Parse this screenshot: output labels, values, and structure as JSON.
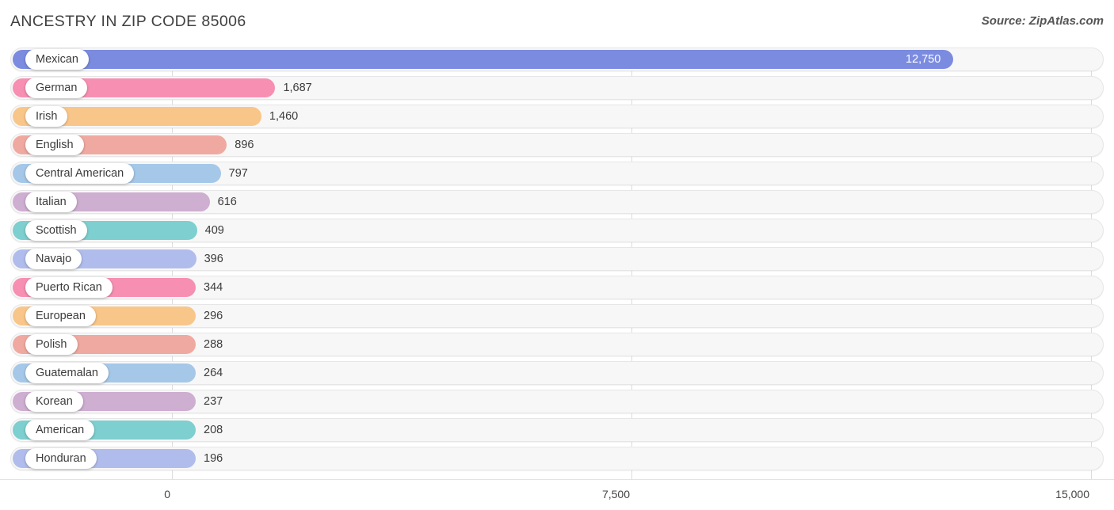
{
  "header": {
    "title": "ANCESTRY IN ZIP CODE 85006",
    "source": "Source: ZipAtlas.com"
  },
  "axis": {
    "ticks": [
      "0",
      "7,500",
      "15,000"
    ]
  },
  "chart_data": {
    "type": "bar",
    "orientation": "horizontal",
    "title": "ANCESTRY IN ZIP CODE 85006",
    "subtitle": "Source: ZipAtlas.com",
    "xlabel": "",
    "ylabel": "",
    "xlim": [
      0,
      15000
    ],
    "xticks": [
      0,
      7500,
      15000
    ],
    "xtick_labels": [
      "0",
      "7,500",
      "15,000"
    ],
    "grid": true,
    "legend": false,
    "categories": [
      "Mexican",
      "German",
      "Irish",
      "English",
      "Central American",
      "Italian",
      "Scottish",
      "Navajo",
      "Puerto Rican",
      "European",
      "Polish",
      "Guatemalan",
      "Korean",
      "American",
      "Honduran"
    ],
    "values": [
      12750,
      1687,
      1460,
      896,
      797,
      616,
      409,
      396,
      344,
      296,
      288,
      264,
      237,
      208,
      196
    ],
    "value_labels": [
      "12,750",
      "1,687",
      "1,460",
      "896",
      "797",
      "616",
      "409",
      "396",
      "344",
      "296",
      "288",
      "264",
      "237",
      "208",
      "196"
    ],
    "colors": [
      "#7b8be0",
      "#f78fb3",
      "#f9c68a",
      "#f0a9a0",
      "#a5c8e8",
      "#ceaed1",
      "#7ecfcf",
      "#b0bdec",
      "#f78fb3",
      "#f9c68a",
      "#f0a9a0",
      "#a5c8e8",
      "#ceaed1",
      "#7ecfcf",
      "#b0bdec"
    ],
    "bars": [
      {
        "label": "Mexican",
        "value": 12750,
        "value_label": "12,750",
        "color": "#7b8be0",
        "value_inside": true
      },
      {
        "label": "German",
        "value": 1687,
        "value_label": "1,687",
        "color": "#f78fb3",
        "value_inside": false
      },
      {
        "label": "Irish",
        "value": 1460,
        "value_label": "1,460",
        "color": "#f9c68a",
        "value_inside": false
      },
      {
        "label": "English",
        "value": 896,
        "value_label": "896",
        "color": "#f0a9a0",
        "value_inside": false
      },
      {
        "label": "Central American",
        "value": 797,
        "value_label": "797",
        "color": "#a5c8e8",
        "value_inside": false
      },
      {
        "label": "Italian",
        "value": 616,
        "value_label": "616",
        "color": "#ceaed1",
        "value_inside": false
      },
      {
        "label": "Scottish",
        "value": 409,
        "value_label": "409",
        "color": "#7ecfcf",
        "value_inside": false
      },
      {
        "label": "Navajo",
        "value": 396,
        "value_label": "396",
        "color": "#b0bdec",
        "value_inside": false
      },
      {
        "label": "Puerto Rican",
        "value": 344,
        "value_label": "344",
        "color": "#f78fb3",
        "value_inside": false
      },
      {
        "label": "European",
        "value": 296,
        "value_label": "296",
        "color": "#f9c68a",
        "value_inside": false
      },
      {
        "label": "Polish",
        "value": 288,
        "value_label": "288",
        "color": "#f0a9a0",
        "value_inside": false
      },
      {
        "label": "Guatemalan",
        "value": 264,
        "value_label": "264",
        "color": "#a5c8e8",
        "value_inside": false
      },
      {
        "label": "Korean",
        "value": 237,
        "value_label": "237",
        "color": "#ceaed1",
        "value_inside": false
      },
      {
        "label": "American",
        "value": 208,
        "value_label": "208",
        "color": "#7ecfcf",
        "value_inside": false
      },
      {
        "label": "Honduran",
        "value": 196,
        "value_label": "196",
        "color": "#b0bdec",
        "value_inside": false
      }
    ]
  }
}
